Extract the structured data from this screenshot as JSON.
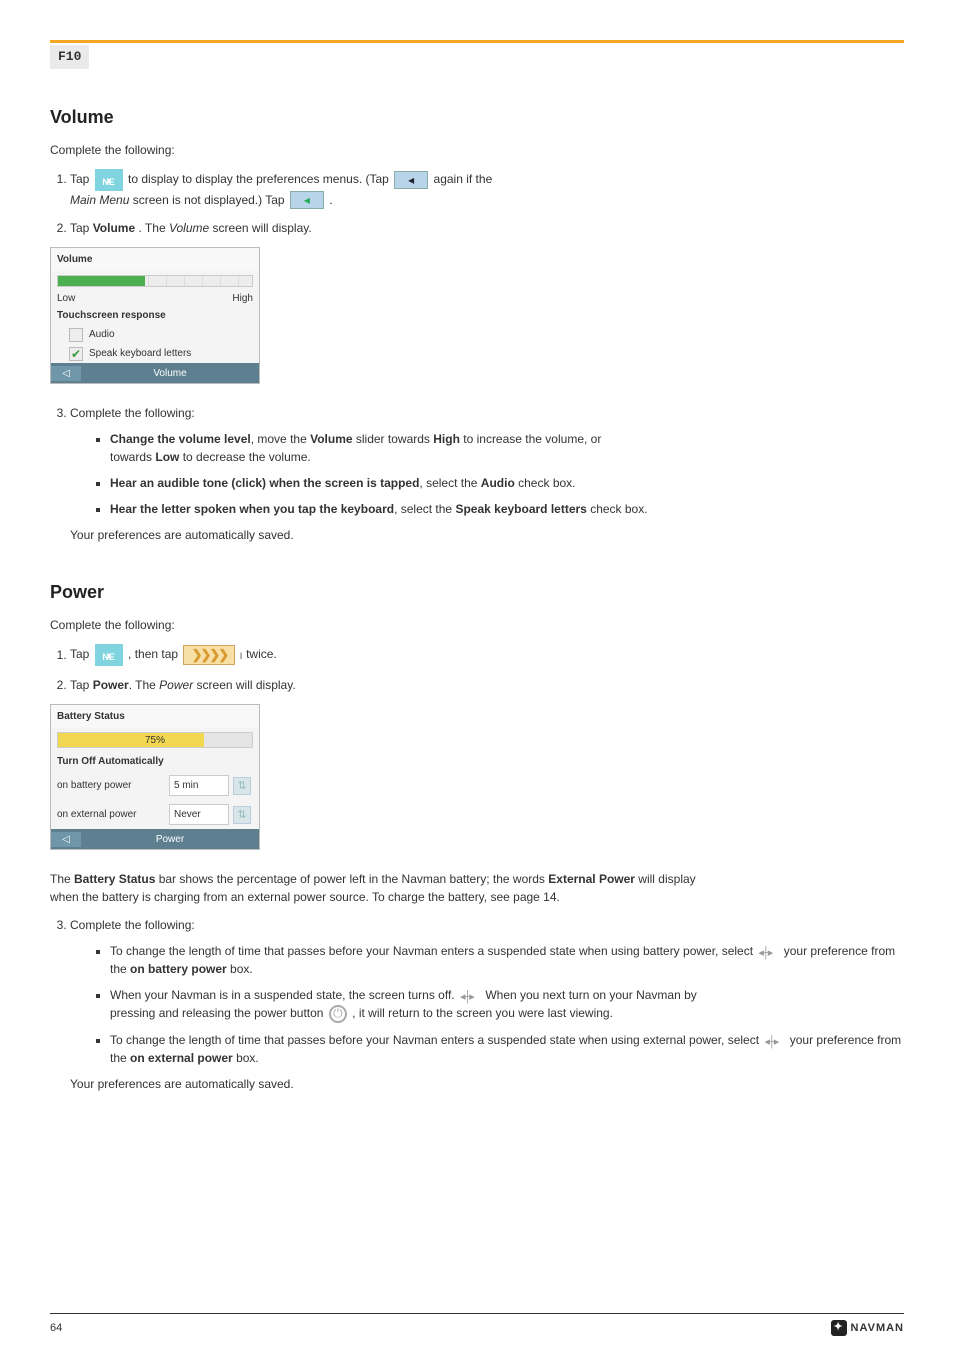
{
  "header": {
    "label": "F10"
  },
  "volume": {
    "title": "Volume",
    "intro": "Complete the following:",
    "steps": [
      {
        "type": "nav1",
        "pre": "Tap ",
        "icon": "ne",
        "mid1": " to display ",
        "mid2": " to display the preferences menus. (Tap ",
        "icon2": "back",
        "post": " again if the"
      },
      {
        "type": "nav2",
        "pre": "Main Menu",
        "mid": " screen is not displayed.) Tap ",
        "icon": "back",
        "post": "."
      },
      {
        "type": "tap",
        "text": "Tap ",
        "strong": "Volume",
        "suffix": ". The ",
        "screen": "Volume",
        "end": " screen will display."
      }
    ],
    "screenshot": {
      "title": "Volume",
      "low": "Low",
      "high": "High",
      "fill_pct": 45,
      "section": "Touchscreen response",
      "opt_audio": "Audio",
      "opt_speak": "Speak keyboard letters",
      "footer": "Volume"
    },
    "steps2_title": "Complete the following:",
    "steps2": [
      {
        "strong": "Change the volume level",
        "rest": ", move the ",
        "strong2": "Volume",
        "rest2": " slider towards ",
        "strong3": "High",
        "rest3": " to increase the volume, or"
      },
      {
        "cont": "towards ",
        "strong": "Low",
        "rest": " to decrease the volume."
      },
      {
        "strong": "Hear an audible tone (click) when the screen is tapped",
        "rest": ", select the ",
        "strong2": "Audio",
        "rest2": " check box."
      },
      {
        "strong": "Hear the letter spoken when you tap the keyboard",
        "rest": ", select the ",
        "strong2": "Speak keyboard letters",
        "rest2": " check box."
      }
    ],
    "save_note": "Your preferences are automatically saved."
  },
  "power": {
    "title": "Power",
    "intro": "Complete the following:",
    "nav": {
      "pre": "Tap ",
      "icon": "ne",
      "mid": ", then tap ",
      "icon2": "chevrons",
      "post": " twice."
    },
    "tap": {
      "pre": "Tap ",
      "strong": "Power",
      "mid": ". The ",
      "screen": "Power",
      "end": " screen will display."
    },
    "screenshot": {
      "title": "Battery Status",
      "pct": "75%",
      "fill_pct": 75,
      "section": "Turn Off Automatically",
      "row1_label": "on battery power",
      "row1_value": "5 min",
      "row2_label": "on external power",
      "row2_value": "Never",
      "footer": "Power"
    },
    "desc": {
      "l1_pre": "The ",
      "l1_strong": "Battery Status",
      "l1_rest": " bar shows the percentage of power left in the Navman battery; the words ",
      "l1_strong2": "External Power",
      "l1_rest2": " will display",
      "l2": "when the battery is charging from an external power source. To charge the battery, see page 14."
    },
    "steps2_title": "Complete the following:",
    "bullets": [
      {
        "bPre": "To change the length of time that passes before your Navman enters a suspended state when using battery power, select ",
        "iconA": "updown",
        "bMid": " your preference from the ",
        "bStrong": "on battery power",
        "bRest": " box."
      },
      {
        "bPre": "When your Navman is in a suspended state, the screen turns off. ",
        "iconA": "updown",
        "bMid": " When you next turn on your Navman by",
        "l2pre": "pressing and releasing the power button ",
        "iconB": "power",
        "l2post": " , it will return to the screen you were last viewing."
      },
      {
        "bPre": "To change the length of time that passes before your Navman enters a suspended state when using external power, select ",
        "iconA": "updown",
        "bMid": " your preference from the ",
        "bStrong": "on external power",
        "bRest": " box."
      }
    ],
    "save_note": "Your preferences are automatically saved."
  },
  "footer": {
    "page": "64",
    "brand": "NAVMAN"
  }
}
